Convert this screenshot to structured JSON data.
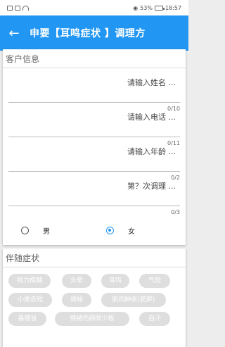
{
  "status": {
    "time": "18:57",
    "battery": "53%"
  },
  "appbar": {
    "title": "申要【耳鸣症状 】调理方"
  },
  "customer_info": {
    "section_title": "客户信息",
    "fields": [
      {
        "placeholder": "请输入姓名 ...",
        "count": "0/10"
      },
      {
        "placeholder": "请输入电话 ...",
        "count": "0/11"
      },
      {
        "placeholder": "请输入年龄 ...",
        "count": "0/2"
      },
      {
        "placeholder": "第？次调理 ...",
        "count": "0/3"
      }
    ],
    "gender": {
      "male_label": "男",
      "female_label": "女",
      "selected": "female"
    }
  },
  "symptoms": {
    "section_title": "伴随症状",
    "chips": [
      "视力模糊",
      "头晕",
      "耳鸣",
      "气短",
      "小便赤短",
      "便秘",
      "肌肉肿胀(肥胖)",
      "易感冒",
      "情绪伤肺同少极",
      "自汗"
    ]
  },
  "colors": {
    "primary": "#2196f3",
    "chip_bg": "#dedede",
    "page_bg": "#ededed"
  }
}
